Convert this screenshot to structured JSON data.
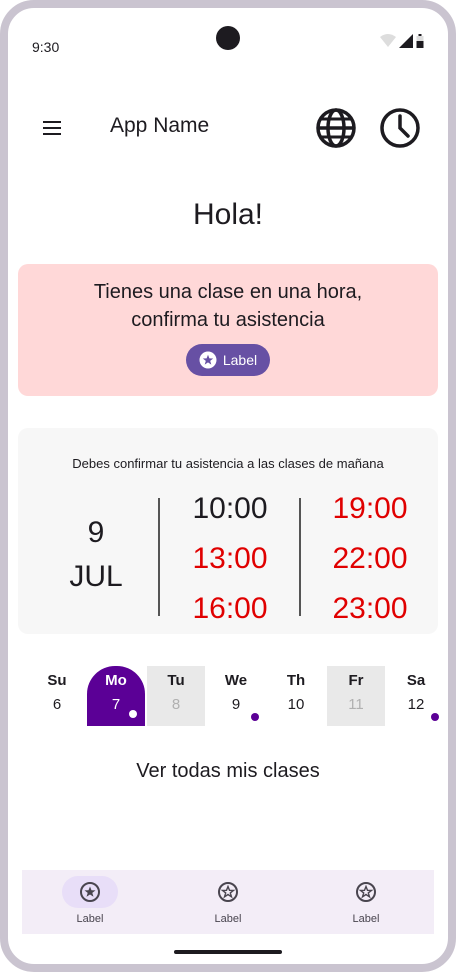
{
  "status_bar": {
    "time": "9:30"
  },
  "app_bar": {
    "title": "App Name",
    "icons": [
      "menu-icon",
      "globe-icon",
      "clock-icon"
    ]
  },
  "greeting": "Hola!",
  "alert": {
    "line1": "Tienes una clase en una hora,",
    "line2": "confirma tu asistencia",
    "chip_label": "Label"
  },
  "schedule": {
    "heading": "Debes confirmar tu asistencia a las clases de mañana",
    "date_day": "9",
    "date_month": "JUL",
    "times": [
      {
        "time": "10:00",
        "status": "black"
      },
      {
        "time": "13:00",
        "status": "red"
      },
      {
        "time": "16:00",
        "status": "red"
      },
      {
        "time": "19:00",
        "status": "red"
      },
      {
        "time": "22:00",
        "status": "red"
      },
      {
        "time": "23:00",
        "status": "red"
      }
    ]
  },
  "week": [
    {
      "name": "Su",
      "date": "6",
      "state": "normal",
      "dot": false
    },
    {
      "name": "Mo",
      "date": "7",
      "state": "selected",
      "dot": true
    },
    {
      "name": "Tu",
      "date": "8",
      "state": "disabled",
      "dot": false
    },
    {
      "name": "We",
      "date": "9",
      "state": "normal",
      "dot": true
    },
    {
      "name": "Th",
      "date": "10",
      "state": "normal",
      "dot": false
    },
    {
      "name": "Fr",
      "date": "11",
      "state": "disabled",
      "dot": false
    },
    {
      "name": "Sa",
      "date": "12",
      "state": "normal",
      "dot": true
    }
  ],
  "view_all": "Ver todas mis clases",
  "bottom_nav": {
    "items": [
      {
        "label": "Label",
        "active": true
      },
      {
        "label": "Label",
        "active": false
      },
      {
        "label": "Label",
        "active": false
      }
    ]
  },
  "colors": {
    "accent": "#6750a4",
    "selected_day": "#5b0096",
    "alert_bg": "#ffd8d8",
    "alert_time": "#e00000"
  }
}
